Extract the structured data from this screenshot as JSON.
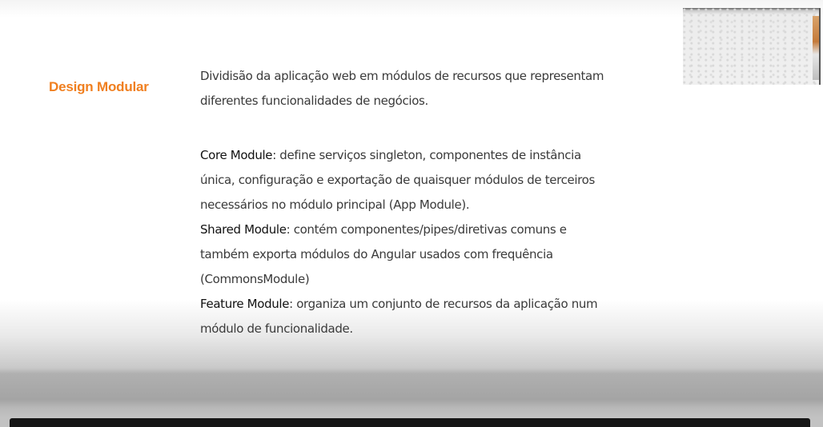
{
  "slide": {
    "title": "Design Modular",
    "intro": "Dividisão da aplicação web em módulos de recursos que representam diferentes funcionalidades de negócios.",
    "modules": [
      {
        "name": "Core Module",
        "description": ": define serviços singleton, componentes de instância única, configuração e exportação de quaisquer módulos de terceiros necessários no módulo principal (App Module)."
      },
      {
        "name": "Shared Module",
        "description": ": contém componentes/pipes/diretivas comuns e também exporta módulos do Angular usados com frequência (CommonsModule)"
      },
      {
        "name": "Feature Module",
        "description": ": organiza um conjunto de recursos da aplicação num módulo de funcionalidade."
      }
    ]
  },
  "colors": {
    "title": "#f07f1f",
    "body_text": "#3a3a3a",
    "bottom_bar": "#161616"
  }
}
